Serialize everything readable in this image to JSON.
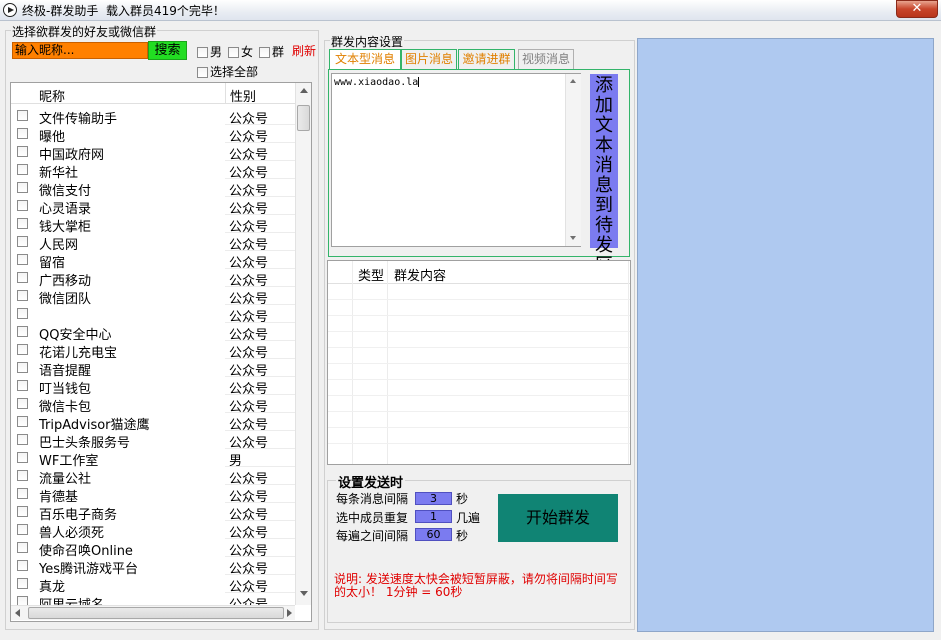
{
  "window": {
    "title": "终极-群发助手  载入群员419个完毕！",
    "close_label": "✕"
  },
  "left": {
    "group_label": "选择欲群发的好友或微信群",
    "search": {
      "value": "输入昵称...",
      "button": "搜索"
    },
    "filters": {
      "male": "男",
      "female": "女",
      "group": "群",
      "refresh": "刷新",
      "select_all": "选择全部"
    },
    "columns": {
      "name": "昵称",
      "gender": "性别"
    },
    "rows": [
      {
        "name": "文件传输助手",
        "gender": "公众号"
      },
      {
        "name": "曝他",
        "gender": "公众号"
      },
      {
        "name": "中国政府网",
        "gender": "公众号"
      },
      {
        "name": "新华社",
        "gender": "公众号"
      },
      {
        "name": "微信支付",
        "gender": "公众号"
      },
      {
        "name": "心灵语录",
        "gender": "公众号"
      },
      {
        "name": "钱大掌柜",
        "gender": "公众号"
      },
      {
        "name": "人民网",
        "gender": "公众号"
      },
      {
        "name": "留宿",
        "gender": "公众号"
      },
      {
        "name": "广西移动",
        "gender": "公众号"
      },
      {
        "name": "微信团队",
        "gender": "公众号"
      },
      {
        "name": "",
        "gender": "公众号"
      },
      {
        "name": "QQ安全中心",
        "gender": "公众号"
      },
      {
        "name": "花诺儿充电宝",
        "gender": "公众号"
      },
      {
        "name": "语音提醒",
        "gender": "公众号"
      },
      {
        "name": "叮当钱包",
        "gender": "公众号"
      },
      {
        "name": "微信卡包",
        "gender": "公众号"
      },
      {
        "name": "TripAdvisor猫途鹰",
        "gender": "公众号"
      },
      {
        "name": "巴士头条服务号",
        "gender": "公众号"
      },
      {
        "name": "WF工作室",
        "gender": "男"
      },
      {
        "name": "流量公社",
        "gender": "公众号"
      },
      {
        "name": "肯德基",
        "gender": "公众号"
      },
      {
        "name": "百乐电子商务",
        "gender": "公众号"
      },
      {
        "name": "兽人必须死",
        "gender": "公众号"
      },
      {
        "name": "使命召唤Online",
        "gender": "公众号"
      },
      {
        "name": "Yes腾讯游戏平台",
        "gender": "公众号"
      },
      {
        "name": "真龙",
        "gender": "公众号"
      },
      {
        "name": "阿里云域名",
        "gender": "公众号"
      }
    ]
  },
  "content": {
    "group_label": "群发内容设置",
    "tabs": [
      {
        "label": "文本型消息",
        "color": "#e08000"
      },
      {
        "label": "图片消息",
        "color": "#e08000"
      },
      {
        "label": "邀请进群",
        "color": "#e08000"
      },
      {
        "label": "视频消息",
        "color": "#808080"
      }
    ],
    "text_value": "www.xiaodao.la",
    "add_button": "添加文本消息到待发区",
    "queue_columns": {
      "type": "类型",
      "content": "群发内容"
    }
  },
  "settings": {
    "title": "设置发送时",
    "rows": [
      {
        "label": "每条消息间隔",
        "value": "3",
        "unit": "秒"
      },
      {
        "label": "选中成员重复",
        "value": "1",
        "unit": "几遍"
      },
      {
        "label": "每遍之间间隔",
        "value": "60",
        "unit": "秒"
      }
    ],
    "start_button": "开始群发",
    "note": "说明: 发送速度太快会被短暂屏蔽，请勿将间隔时间写的太小！ 1分钟 = 60秒"
  },
  "colors": {
    "search_bg": "#ff8000",
    "search_btn": "#22dd22",
    "accent_blue": "#7b7bf0",
    "start_btn": "#108474",
    "right_pane": "#afc9f0",
    "warning": "#e00000"
  }
}
